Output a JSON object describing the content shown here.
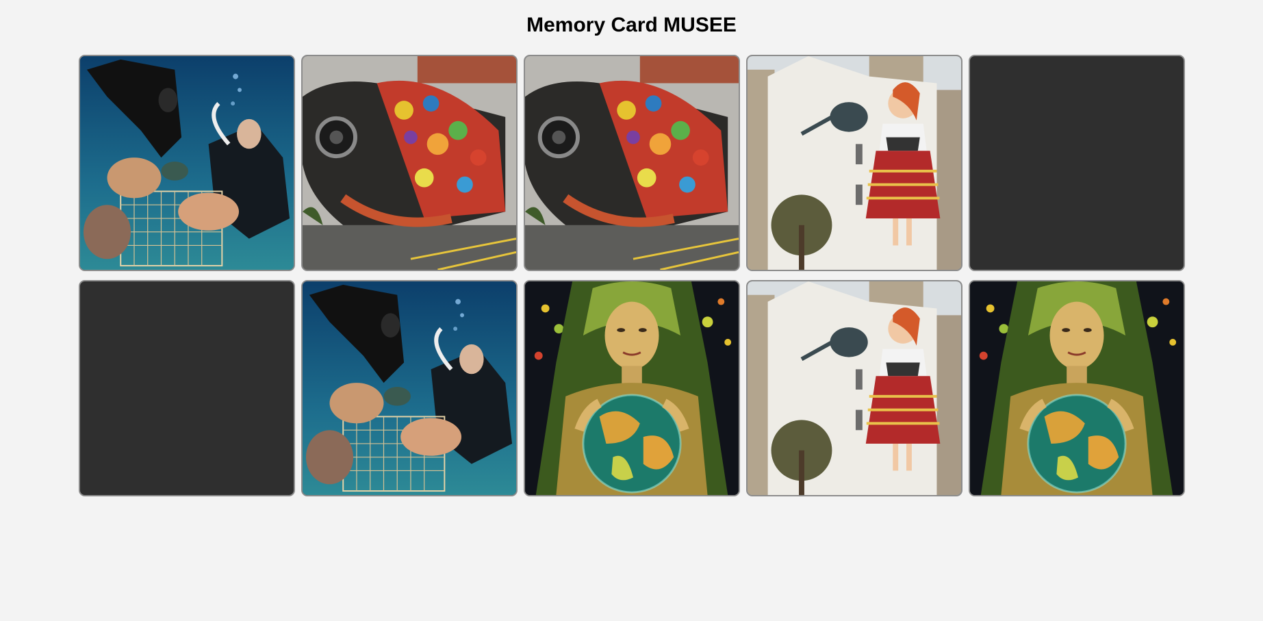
{
  "title": "Memory Card MUSEE",
  "cards": [
    {
      "state": "revealed",
      "image": "divers-coral-reef"
    },
    {
      "state": "revealed",
      "image": "junk-art-fish-mural"
    },
    {
      "state": "revealed",
      "image": "junk-art-fish-mural"
    },
    {
      "state": "revealed",
      "image": "girl-watering-can-mural"
    },
    {
      "state": "hidden",
      "image": ""
    },
    {
      "state": "hidden",
      "image": ""
    },
    {
      "state": "revealed",
      "image": "divers-coral-reef"
    },
    {
      "state": "revealed",
      "image": "earth-goddess-globe"
    },
    {
      "state": "revealed",
      "image": "girl-watering-can-mural"
    },
    {
      "state": "revealed",
      "image": "earth-goddess-globe"
    }
  ],
  "card_back_color": "#2f2f2f",
  "background_color": "#f3f3f3"
}
